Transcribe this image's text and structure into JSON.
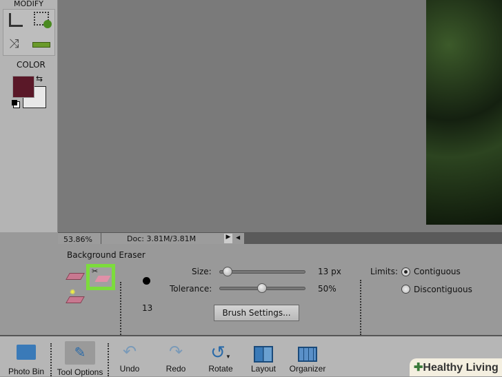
{
  "leftbar": {
    "section_modify": "MODIFY",
    "section_color": "COLOR",
    "foreground_color": "#5a1828",
    "background_color": "#e8e8e8"
  },
  "status": {
    "zoom": "53.86%",
    "doc": "Doc: 3.81M/3.81M"
  },
  "options": {
    "tool_name": "Background Eraser",
    "brush_size_preview": "13",
    "size_label": "Size:",
    "size_value": "13 px",
    "size_fraction": 0.05,
    "tolerance_label": "Tolerance:",
    "tolerance_value": "50%",
    "tolerance_fraction": 0.5,
    "brush_settings": "Brush Settings...",
    "limits_label": "Limits:",
    "limit_options": [
      "Contiguous",
      "Discontiguous"
    ],
    "selected_limit": "Contiguous",
    "highlight_color": "#7cdc3c"
  },
  "bottom": {
    "buttons": [
      "Photo Bin",
      "Tool Options",
      "Undo",
      "Redo",
      "Rotate",
      "Layout",
      "Organizer"
    ]
  },
  "watermark": "Healthy Living"
}
